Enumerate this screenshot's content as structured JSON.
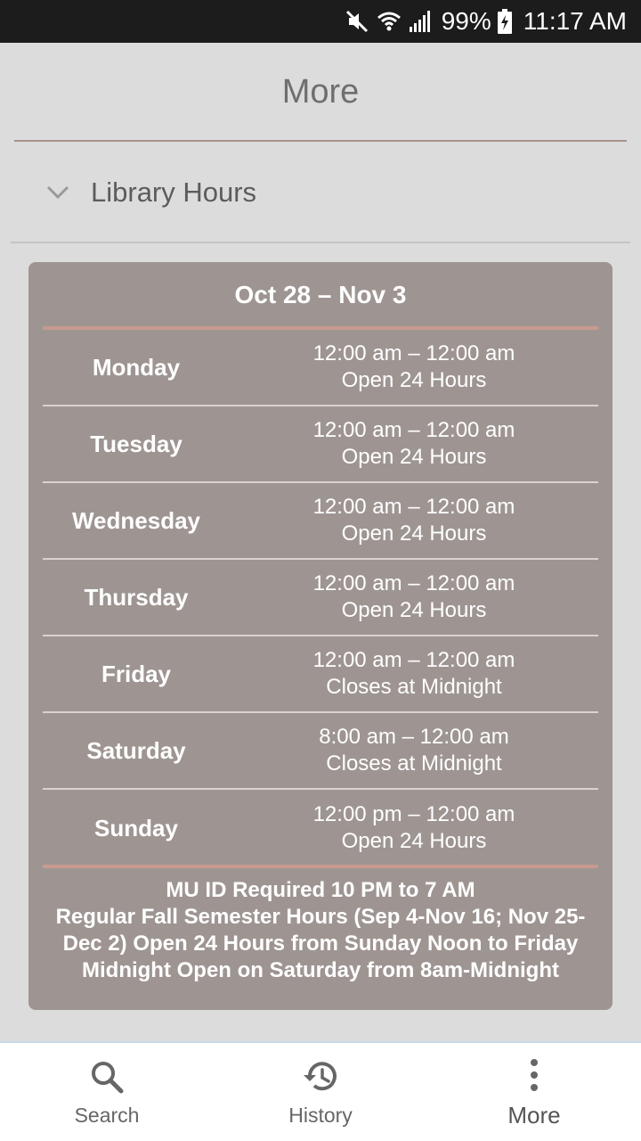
{
  "status_bar": {
    "battery": "99%",
    "time": "11:17 AM",
    "icons": [
      "mute-icon",
      "wifi-icon",
      "signal-icon",
      "battery-charging-icon"
    ]
  },
  "header": {
    "title": "More"
  },
  "section": {
    "label": "Library Hours",
    "icon": "chevron-down-icon"
  },
  "hours": {
    "week": "Oct 28 – Nov 3",
    "days": [
      {
        "day": "Monday",
        "time": "12:00 am – 12:00 am",
        "note": "Open 24 Hours"
      },
      {
        "day": "Tuesday",
        "time": "12:00 am – 12:00 am",
        "note": "Open 24 Hours"
      },
      {
        "day": "Wednesday",
        "time": "12:00 am – 12:00 am",
        "note": "Open 24 Hours"
      },
      {
        "day": "Thursday",
        "time": "12:00 am – 12:00 am",
        "note": "Open 24 Hours"
      },
      {
        "day": "Friday",
        "time": "12:00 am – 12:00 am",
        "note": "Closes at Midnight"
      },
      {
        "day": "Saturday",
        "time": "8:00 am – 12:00 am",
        "note": "Closes at Midnight"
      },
      {
        "day": "Sunday",
        "time": "12:00 pm – 12:00 am",
        "note": "Open 24 Hours"
      }
    ],
    "notes": [
      "MU ID Required 10 PM to 7 AM",
      "Regular Fall Semester Hours (Sep 4-Nov 16; Nov 25-",
      "Dec 2) Open 24 Hours from Sunday Noon to Friday",
      "Midnight Open on Saturday from 8am-Midnight"
    ]
  },
  "bottom_nav": {
    "items": [
      {
        "label": "Search",
        "icon": "search-icon"
      },
      {
        "label": "History",
        "icon": "history-icon"
      },
      {
        "label": "More",
        "icon": "more-vertical-icon",
        "active": true
      }
    ]
  },
  "colors": {
    "card_bg": "#9e9592",
    "accent_rule": "#c79a8f",
    "page_bg": "#dcdcdc",
    "status_bar_bg": "#1c1c1c"
  }
}
